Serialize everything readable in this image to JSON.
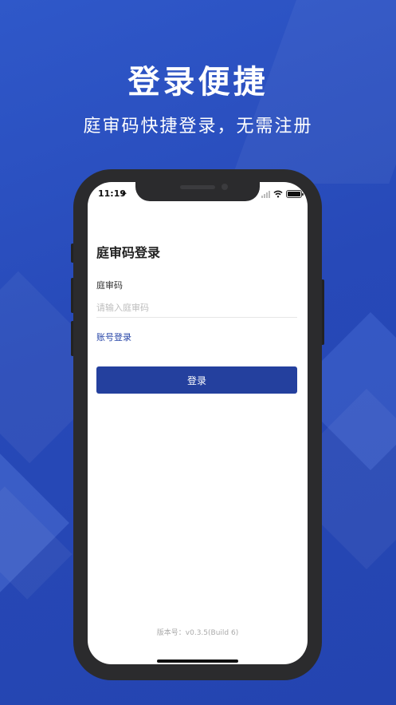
{
  "colors": {
    "background": "#2749b8",
    "accent": "#24409e",
    "link": "#2644a7"
  },
  "promo": {
    "headline": "登录便捷",
    "subline": "庭审码快捷登录，无需注册"
  },
  "status_bar": {
    "time": "11:19",
    "icons": [
      "location-arrow-icon",
      "signal-icon",
      "wifi-icon",
      "battery-icon"
    ]
  },
  "login": {
    "title": "庭审码登录",
    "field_label": "庭审码",
    "field_placeholder": "请输入庭审码",
    "field_value": "",
    "account_link": "账号登录",
    "submit_label": "登录"
  },
  "footer": {
    "version": "版本号：v0.3.5(Build 6)"
  }
}
